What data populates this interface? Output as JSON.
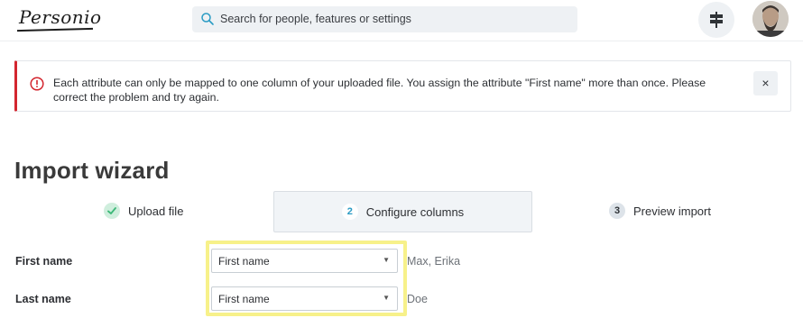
{
  "header": {
    "logo_text": "Personio",
    "search_placeholder": "Search for people, features or settings"
  },
  "alert": {
    "message": "Each attribute can only be mapped to one column of your uploaded file. You assign the attribute \"First name\" more than once. Please correct the problem and try again.",
    "close_label": "×"
  },
  "page": {
    "title": "Import wizard"
  },
  "steps": [
    {
      "number": "✓",
      "label": "Upload file",
      "state": "done"
    },
    {
      "number": "2",
      "label": "Configure columns",
      "state": "active"
    },
    {
      "number": "3",
      "label": "Preview import",
      "state": "todo"
    }
  ],
  "mapping": [
    {
      "column": "First name",
      "attribute": "First name",
      "sample": "Max, Erika"
    },
    {
      "column": "Last name",
      "attribute": "First name",
      "sample": "Doe"
    }
  ],
  "colors": {
    "error": "#d3262f",
    "accent": "#2a9bc4",
    "success": "#3cb878",
    "highlight": "#f7f18a"
  }
}
